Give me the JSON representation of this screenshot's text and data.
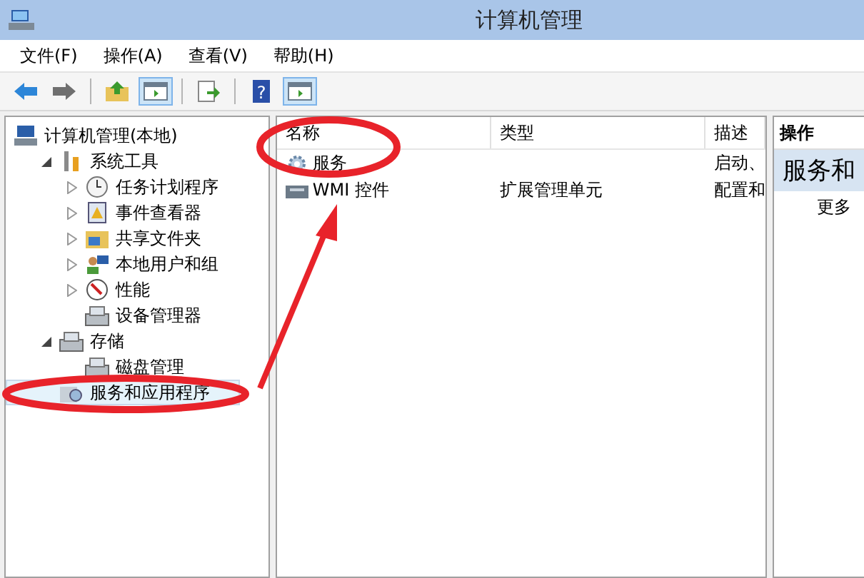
{
  "window": {
    "title": "计算机管理"
  },
  "menu": [
    "文件(F)",
    "操作(A)",
    "查看(V)",
    "帮助(H)"
  ],
  "toolbar": [
    {
      "kind": "back"
    },
    {
      "kind": "forward"
    },
    {
      "kind": "sep"
    },
    {
      "kind": "up"
    },
    {
      "kind": "tree-toggle",
      "on": true
    },
    {
      "kind": "sep"
    },
    {
      "kind": "export"
    },
    {
      "kind": "sep"
    },
    {
      "kind": "help",
      "glyph": "?"
    },
    {
      "kind": "action-toggle",
      "on": true
    }
  ],
  "tree": {
    "label": "计算机管理(本地)",
    "kind": "computer",
    "selected": false,
    "children": [
      {
        "label": "系统工具",
        "kind": "tools",
        "expanded": true,
        "selected": false,
        "children": [
          {
            "label": "任务计划程序",
            "kind": "clock",
            "expanded": false,
            "selected": false
          },
          {
            "label": "事件查看器",
            "kind": "event",
            "expanded": false,
            "selected": false
          },
          {
            "label": "共享文件夹",
            "kind": "share",
            "expanded": false,
            "selected": false
          },
          {
            "label": "本地用户和组",
            "kind": "users",
            "expanded": false,
            "selected": false
          },
          {
            "label": "性能",
            "kind": "perf",
            "expanded": false,
            "selected": false
          },
          {
            "label": "设备管理器",
            "kind": "device",
            "selected": false
          }
        ]
      },
      {
        "label": "存储",
        "kind": "storage",
        "expanded": true,
        "selected": false,
        "children": [
          {
            "label": "磁盘管理",
            "kind": "disk",
            "selected": false
          }
        ]
      },
      {
        "label": "服务和应用程序",
        "kind": "services",
        "selected": true
      }
    ]
  },
  "list": {
    "columns": [
      "名称",
      "类型",
      "描述"
    ],
    "rows": [
      {
        "kind": "gear",
        "name": "服务",
        "description": "启动、"
      },
      {
        "kind": "wmi",
        "name": "WMI 控件",
        "type": "扩展管理单元",
        "description": "配置和"
      }
    ]
  },
  "actions": {
    "title": "操作",
    "section": "服务和",
    "items": [
      "更多"
    ]
  }
}
